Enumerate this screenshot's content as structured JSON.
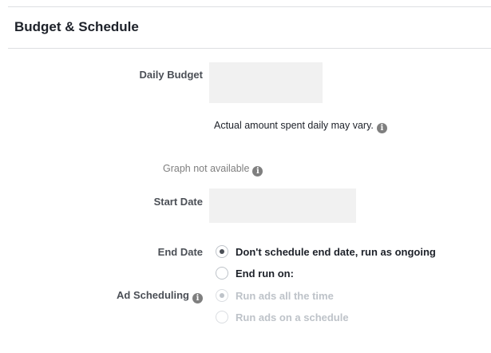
{
  "section": {
    "title": "Budget & Schedule"
  },
  "daily_budget": {
    "label": "Daily Budget",
    "value": "",
    "note": "Actual amount spent daily may vary."
  },
  "graph": {
    "text": "Graph not available"
  },
  "start_date": {
    "label": "Start Date",
    "value": ""
  },
  "end_date": {
    "label": "End Date",
    "options": [
      {
        "label": "Don't schedule end date, run as ongoing",
        "checked": true,
        "disabled": false
      },
      {
        "label": "End run on:",
        "checked": false,
        "disabled": false
      }
    ]
  },
  "ad_scheduling": {
    "label": "Ad Scheduling",
    "options": [
      {
        "label": "Run ads all the time",
        "checked": true,
        "disabled": true
      },
      {
        "label": "Run ads on a schedule",
        "checked": false,
        "disabled": true
      }
    ]
  },
  "icons": {
    "info": "info-icon"
  }
}
